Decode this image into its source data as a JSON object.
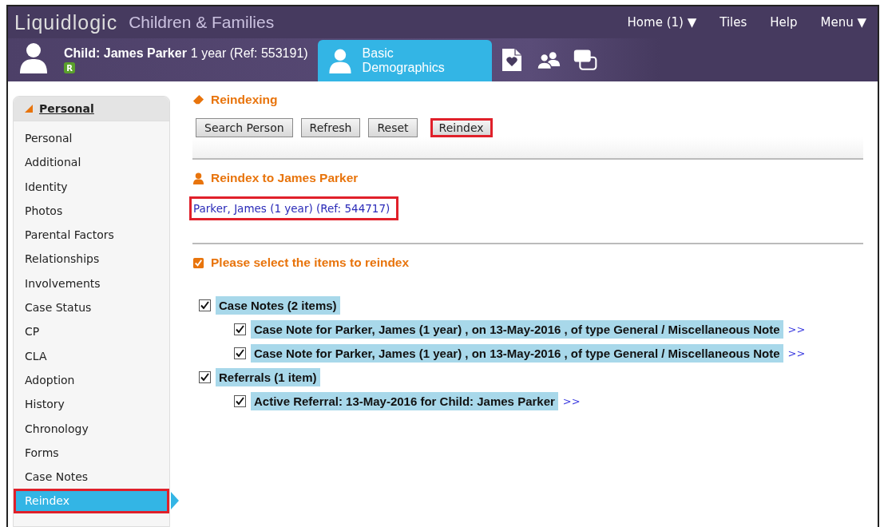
{
  "app": {
    "logo": "Liquidlogic",
    "title": "Children & Families",
    "nav": [
      {
        "label": "Home (1) ▼"
      },
      {
        "label": "Tiles"
      },
      {
        "label": "Help"
      },
      {
        "label": "Menu ▼"
      }
    ]
  },
  "person": {
    "name": "Child: James Parker",
    "details": "1 year (Ref: 553191)",
    "badge": "R"
  },
  "tabs": [
    {
      "label": "Basic Demographics",
      "selected": true
    }
  ],
  "sidebar": {
    "heading": "Personal",
    "expanded": true,
    "items": [
      {
        "label": "Personal",
        "selected": false,
        "highlighted": false
      },
      {
        "label": "Additional",
        "selected": false,
        "highlighted": false
      },
      {
        "label": "Identity",
        "selected": false,
        "highlighted": false
      },
      {
        "label": "Photos",
        "selected": false,
        "highlighted": false
      },
      {
        "label": "Parental Factors",
        "selected": false,
        "highlighted": false
      },
      {
        "label": "Relationships",
        "selected": false,
        "highlighted": false
      },
      {
        "label": "Involvements",
        "selected": false,
        "highlighted": false
      },
      {
        "label": "Case Status",
        "selected": false,
        "highlighted": false
      },
      {
        "label": "CP",
        "selected": false,
        "highlighted": false
      },
      {
        "label": "CLA",
        "selected": false,
        "highlighted": false
      },
      {
        "label": "Adoption",
        "selected": false,
        "highlighted": false
      },
      {
        "label": "History",
        "selected": false,
        "highlighted": false
      },
      {
        "label": "Chronology",
        "selected": false,
        "highlighted": false
      },
      {
        "label": "Forms",
        "selected": false,
        "highlighted": false
      },
      {
        "label": "Case Notes",
        "selected": false,
        "highlighted": false
      },
      {
        "label": "Reindex",
        "selected": true,
        "highlighted": true
      }
    ]
  },
  "reindexing": {
    "title": "Reindexing",
    "buttons": [
      {
        "label": "Search Person",
        "highlighted": false
      },
      {
        "label": "Refresh",
        "highlighted": false
      },
      {
        "label": "Reset",
        "highlighted": false
      },
      {
        "label": "Reindex",
        "highlighted": true
      }
    ]
  },
  "target": {
    "title": "Reindex to James Parker",
    "link": {
      "text": "Parker, James (1 year) (Ref: 544717)",
      "highlighted": true
    }
  },
  "selection": {
    "title": "Please select the items to reindex",
    "items": [
      {
        "label": "Case Notes (2 items)",
        "checked": true,
        "children": [
          {
            "label": "Case Note for Parker, James (1 year) , on 13-May-2016 , of type General / Miscellaneous Note",
            "checked": true,
            "more": ">>"
          },
          {
            "label": "Case Note for Parker, James (1 year) , on 13-May-2016 , of type General / Miscellaneous Note",
            "checked": true,
            "more": ">>"
          }
        ]
      },
      {
        "label": "Referrals (1 item)",
        "checked": true,
        "children": [
          {
            "label": "Active Referral: 13-May-2016 for Child: James Parker",
            "checked": true,
            "more": ">>"
          }
        ]
      }
    ]
  }
}
